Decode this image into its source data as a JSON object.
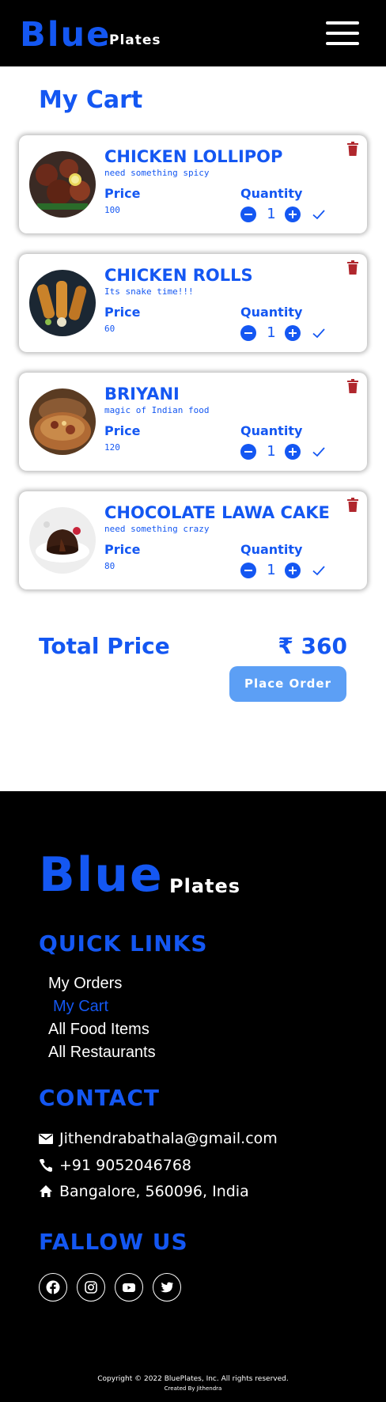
{
  "header": {
    "brand_main": "Blue",
    "brand_sub": "Plates",
    "menu_icon": "hamburger-menu-icon"
  },
  "page_title": "My Cart",
  "cart": {
    "items": [
      {
        "name": "CHICKEN LOLLIPOP",
        "tagline": "need something spicy",
        "price_label": "Price",
        "price": "100",
        "quantity_label": "Quantity",
        "quantity": "1"
      },
      {
        "name": "CHICKEN ROLLS",
        "tagline": "Its snake time!!!",
        "price_label": "Price",
        "price": "60",
        "quantity_label": "Quantity",
        "quantity": "1"
      },
      {
        "name": "BRIYANI",
        "tagline": "magic of Indian food",
        "price_label": "Price",
        "price": "120",
        "quantity_label": "Quantity",
        "quantity": "1"
      },
      {
        "name": "CHOCOLATE LAWA CAKE",
        "tagline": "need something crazy",
        "price_label": "Price",
        "price": "80",
        "quantity_label": "Quantity",
        "quantity": "1"
      }
    ],
    "icons": [
      "minus-circle-icon",
      "plus-circle-icon",
      "check-icon",
      "trash-icon"
    ]
  },
  "summary": {
    "total_label": "Total Price",
    "total_value": "₹ 360",
    "place_order_label": "Place Order"
  },
  "footer": {
    "brand_main": "Blue",
    "brand_sub": "Plates",
    "quick_links_heading": "QUICK LINKS",
    "quick_links": [
      "My Orders",
      "My Cart",
      "All Food Items",
      "All Restaurants"
    ],
    "active_link": "My Cart",
    "contact_heading": "CONTACT",
    "contact": {
      "email": "Jithendrabathala@gmail.com",
      "phone": "+91 9052046768",
      "address": "Bangalore, 560096, India"
    },
    "follow_heading": "FALLOW US",
    "social_icons": [
      "facebook-icon",
      "instagram-icon",
      "youtube-icon",
      "twitter-icon"
    ],
    "copyright": "Copyright © 2022 BluePlates, Inc. All rights reserved.",
    "credit": "Created By Jithendra"
  },
  "colors": {
    "accent": "#1457f2",
    "button": "#5c9ff5",
    "trash": "#b0272d",
    "header_bg": "#000000"
  }
}
